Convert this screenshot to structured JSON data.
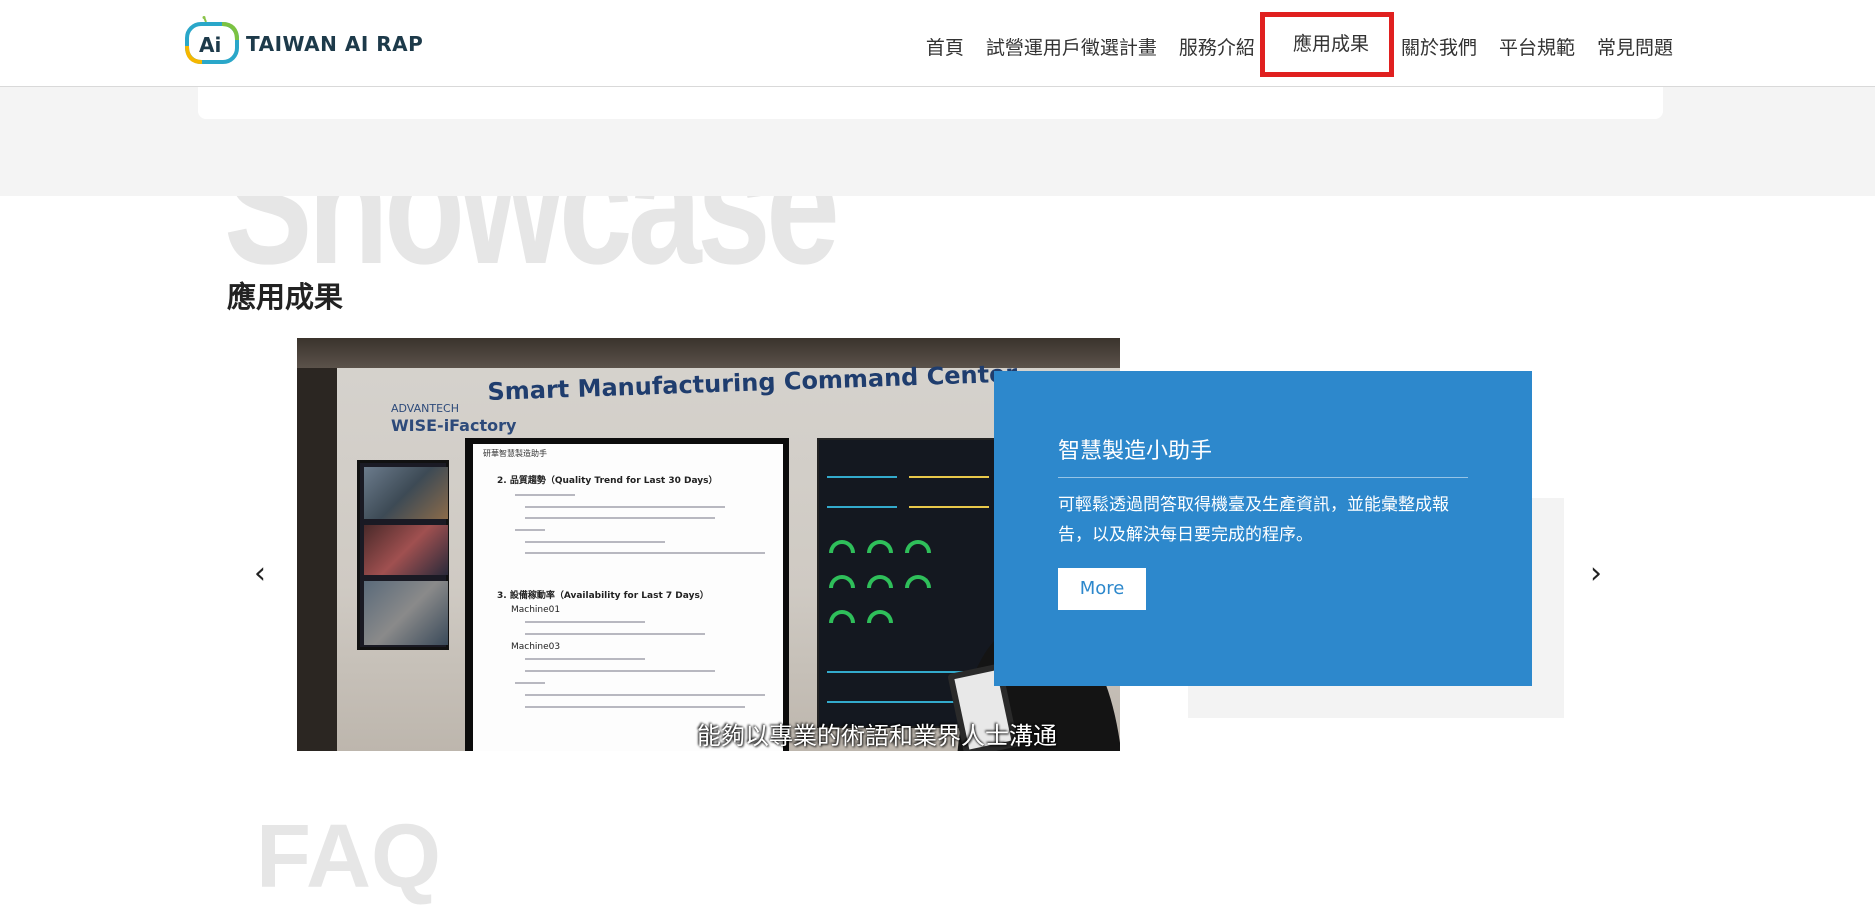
{
  "brand": {
    "logo_text": "TAIWAN AI RAP",
    "logo_mark": "Ai"
  },
  "nav": {
    "items": [
      "首頁",
      "試營運用戶徵選計畫",
      "服務介紹",
      "應用成果",
      "關於我們",
      "平台規範",
      "常見問題"
    ],
    "active_index": 3
  },
  "section": {
    "bg_word": "Showcase",
    "title": "應用成果",
    "bg_word_next": "FAQ"
  },
  "carousel": {
    "prev_icon": "chevron-left-icon",
    "next_icon": "chevron-right-icon",
    "prev_glyph": "‹",
    "next_glyph": "›"
  },
  "photo": {
    "brand_small": "ADVANTECH",
    "wise_label": "WISE-iFactory",
    "headline": "Smart Manufacturing Command Center",
    "doc_top": "研華智慧製造助手",
    "doc_h1": "2. 品質趨勢（Quality Trend for Last 30 Days）",
    "doc_h2": "3. 設備稼動率（Availability for Last 7 Days）",
    "doc_m1": "Machine01",
    "doc_m2": "Machine03",
    "caption": "能夠以專業的術語和業界人士溝通"
  },
  "card": {
    "title": "智慧製造小助手",
    "description": "可輕鬆透過問答取得機臺及生產資訊，並能彙整成報告，以及解決每日要完成的程序。",
    "button_label": "More"
  },
  "colors": {
    "card_blue": "#2d88cc",
    "active_outline": "#e0201f",
    "band_grey": "#f4f4f4"
  }
}
